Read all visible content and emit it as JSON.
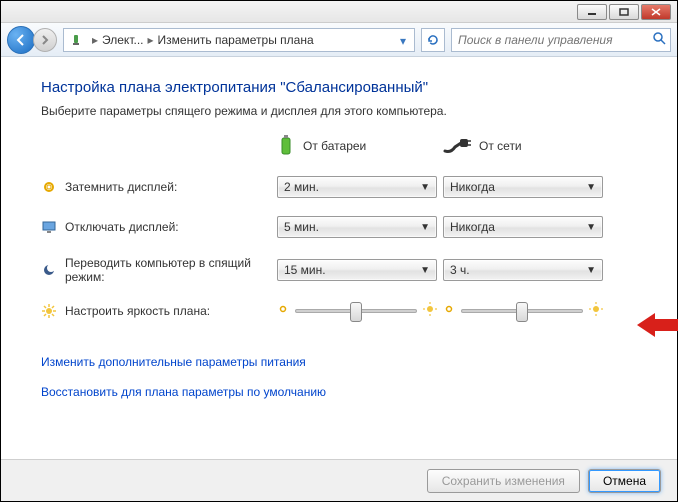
{
  "breadcrumb": {
    "item1": "Элект...",
    "item2": "Изменить параметры плана"
  },
  "search": {
    "placeholder": "Поиск в панели управления"
  },
  "page": {
    "title": "Настройка плана электропитания \"Сбалансированный\"",
    "subheading": "Выберите параметры спящего режима и дисплея для этого компьютера."
  },
  "columns": {
    "battery": "От батареи",
    "ac": "От сети"
  },
  "rows": {
    "dim": {
      "label": "Затемнить дисплей:",
      "battery": "2 мин.",
      "ac": "Никогда"
    },
    "turnoff": {
      "label": "Отключать дисплей:",
      "battery": "5 мин.",
      "ac": "Никогда"
    },
    "sleep": {
      "label": "Переводить компьютер в спящий режим:",
      "battery": "15 мин.",
      "ac": "3 ч."
    },
    "brightness": {
      "label": "Настроить яркость плана:"
    }
  },
  "links": {
    "advanced": "Изменить дополнительные параметры питания",
    "restore": "Восстановить для плана параметры по умолчанию"
  },
  "footer": {
    "save": "Сохранить изменения",
    "cancel": "Отмена"
  }
}
